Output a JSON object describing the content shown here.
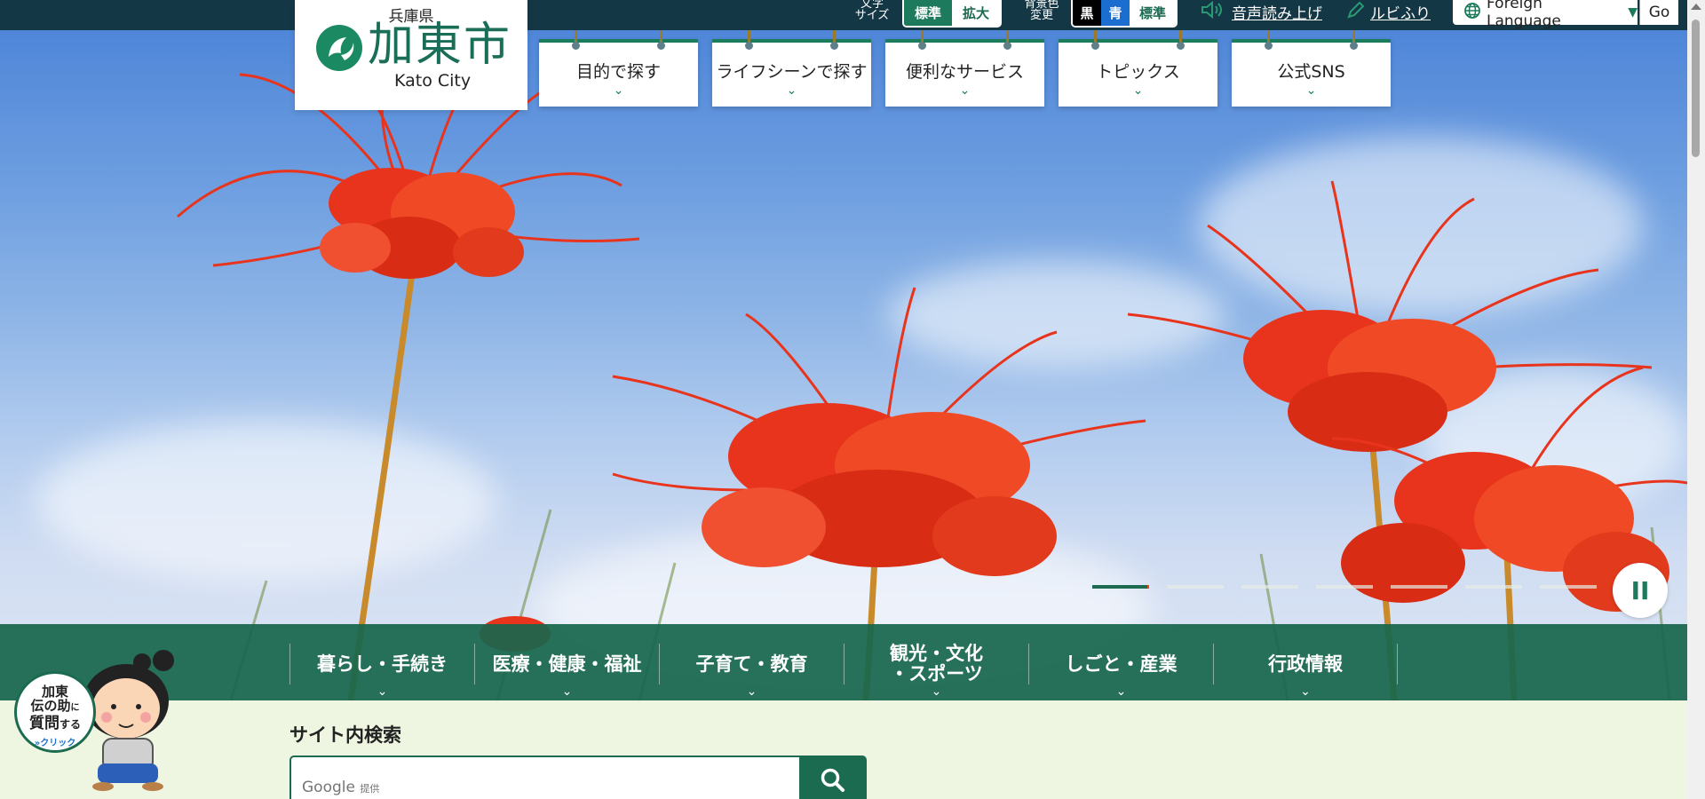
{
  "header": {
    "prefecture": "兵庫県",
    "city_name": "加東市",
    "city_name_en": "Kato City"
  },
  "utility": {
    "font_size_label": "文字\nサイズ",
    "font_size_standard": "標準",
    "font_size_large": "拡大",
    "bg_color_label": "背景色\n変更",
    "bg_black": "黒",
    "bg_blue": "青",
    "bg_standard": "標準",
    "read_aloud": "音声読み上げ",
    "ruby": "ルビふり",
    "foreign_language": "Foreign Language",
    "go": "Go"
  },
  "hang_nav": [
    {
      "label": "目的で探す"
    },
    {
      "label": "ライフシーンで探す"
    },
    {
      "label": "便利なサービス"
    },
    {
      "label": "トピックス"
    },
    {
      "label": "公式SNS"
    }
  ],
  "main_nav": [
    {
      "label": "暮らし・手続き"
    },
    {
      "label": "医療・健康・福祉"
    },
    {
      "label": "子育て・教育"
    },
    {
      "label": "観光・文化\n・スポーツ"
    },
    {
      "label": "しごと・産業"
    },
    {
      "label": "行政情報"
    }
  ],
  "slider": {
    "slide_count": 7,
    "active_index": 0,
    "pause_label": "II"
  },
  "search": {
    "title": "サイト内検索",
    "google_text": "Google",
    "provided_text": "提供"
  },
  "mascot": {
    "line1": "加東",
    "line2": "伝の助",
    "line2_small": "に",
    "line3": "質問",
    "line3_small": "する",
    "click": "»クリック"
  },
  "colors": {
    "brand_green": "#1b6b50",
    "top_bar": "#143746",
    "flower_red": "#e8341c",
    "page_bg": "#eef5e0"
  },
  "icons": {
    "speaker": "speaker-icon",
    "pencil": "pencil-icon",
    "globe": "globe-icon",
    "search": "search-icon",
    "chevron": "chevron-down-icon"
  }
}
